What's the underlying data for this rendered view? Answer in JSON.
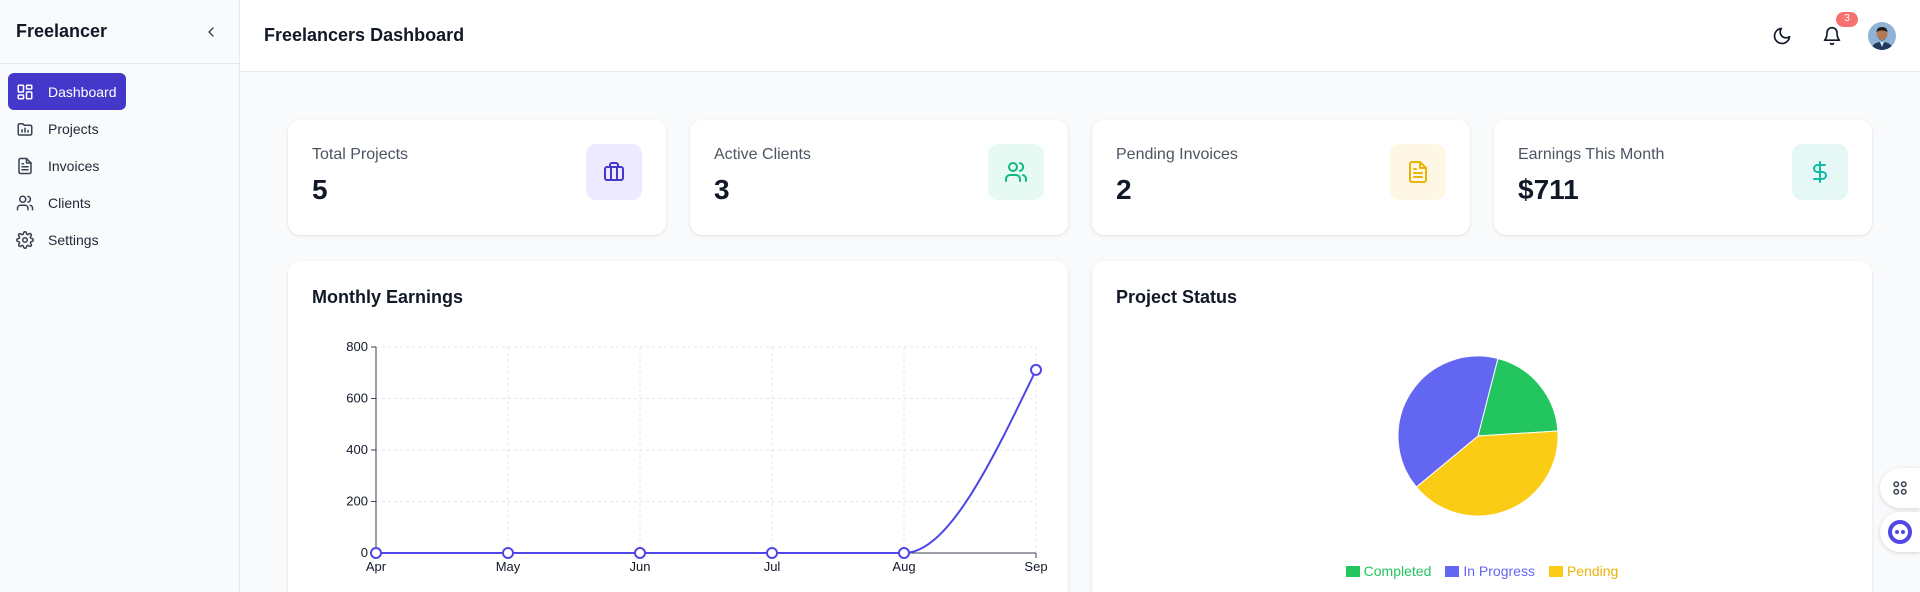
{
  "sidebar": {
    "brand": "Freelancer",
    "items": [
      {
        "label": "Dashboard",
        "icon": "dashboard-grid-icon",
        "active": true
      },
      {
        "label": "Projects",
        "icon": "folder-chart-icon"
      },
      {
        "label": "Invoices",
        "icon": "document-icon"
      },
      {
        "label": "Clients",
        "icon": "users-icon"
      },
      {
        "label": "Settings",
        "icon": "gear-icon"
      }
    ]
  },
  "header": {
    "title": "Freelancers Dashboard",
    "notification_count": "3"
  },
  "stats": [
    {
      "label": "Total Projects",
      "value": "5",
      "icon": "briefcase-icon",
      "color": "#4338ca",
      "bg": "#ede9fe"
    },
    {
      "label": "Active Clients",
      "value": "3",
      "icon": "users-icon",
      "color": "#10b981",
      "bg": "#e6faf3"
    },
    {
      "label": "Pending Invoices",
      "value": "2",
      "icon": "document-icon",
      "color": "#eab308",
      "bg": "#fef7e6"
    },
    {
      "label": "Earnings This Month",
      "value": "$711",
      "icon": "dollar-icon",
      "color": "#14b8a6",
      "bg": "#e6f8f6"
    }
  ],
  "earnings_panel": {
    "title": "Monthly Earnings"
  },
  "status_panel": {
    "title": "Project Status"
  },
  "colors": {
    "accent": "#4338ca",
    "line": "#4f46e5",
    "completed": "#22c55e",
    "in_progress": "#6366f1",
    "pending": "#facc15"
  },
  "chart_data": [
    {
      "type": "line",
      "title": "Monthly Earnings",
      "x": [
        "Apr",
        "May",
        "Jun",
        "Jul",
        "Aug",
        "Sep"
      ],
      "series": [
        {
          "values": [
            0,
            0,
            0,
            0,
            0,
            711
          ]
        }
      ],
      "ylim": [
        0,
        800
      ],
      "yticks": [
        0,
        200,
        400,
        600,
        800
      ],
      "grid": true
    },
    {
      "type": "pie",
      "title": "Project Status",
      "categories": [
        "Completed",
        "In Progress",
        "Pending"
      ],
      "values": [
        1,
        2,
        2
      ],
      "legend": "bottom"
    }
  ]
}
